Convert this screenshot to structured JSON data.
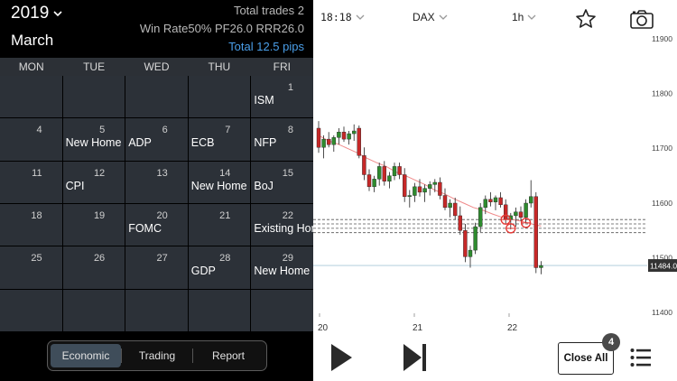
{
  "calendar": {
    "year": "2019",
    "month": "March",
    "stats": {
      "total_trades": "Total trades 2",
      "rates": "Win Rate50% PF26.0 RRR26.0",
      "total_pips": "Total 12.5 pips"
    },
    "weekdays": [
      "MON",
      "TUE",
      "WED",
      "THU",
      "FRI"
    ],
    "cells": [
      {
        "day": "",
        "event": ""
      },
      {
        "day": "",
        "event": ""
      },
      {
        "day": "",
        "event": ""
      },
      {
        "day": "",
        "event": ""
      },
      {
        "day": "1",
        "event": "ISM"
      },
      {
        "day": "4",
        "event": ""
      },
      {
        "day": "5",
        "event": "New Home"
      },
      {
        "day": "6",
        "event": "ADP"
      },
      {
        "day": "7",
        "event": "ECB"
      },
      {
        "day": "8",
        "event": "NFP"
      },
      {
        "day": "11",
        "event": ""
      },
      {
        "day": "12",
        "event": "CPI"
      },
      {
        "day": "13",
        "event": ""
      },
      {
        "day": "14",
        "event": "New Home"
      },
      {
        "day": "15",
        "event": "BoJ"
      },
      {
        "day": "18",
        "event": ""
      },
      {
        "day": "19",
        "event": ""
      },
      {
        "day": "20",
        "event": "FOMC"
      },
      {
        "day": "21",
        "event": ""
      },
      {
        "day": "22",
        "event": "Existing Hor"
      },
      {
        "day": "25",
        "event": ""
      },
      {
        "day": "26",
        "event": ""
      },
      {
        "day": "27",
        "event": ""
      },
      {
        "day": "28",
        "event": "GDP"
      },
      {
        "day": "29",
        "event": "New Home"
      },
      {
        "day": "",
        "event": ""
      },
      {
        "day": "",
        "event": ""
      },
      {
        "day": "",
        "event": ""
      },
      {
        "day": "",
        "event": ""
      },
      {
        "day": "",
        "event": ""
      }
    ],
    "tabs": [
      {
        "label": "Economic",
        "active": true
      },
      {
        "label": "Trading",
        "active": false
      },
      {
        "label": "Report",
        "active": false
      }
    ]
  },
  "chart": {
    "time": "18:18",
    "symbol": "DAX",
    "interval": "1h",
    "price_labels": [
      "11900",
      "11800",
      "11700",
      "11600",
      "11500",
      "11400"
    ],
    "current_price": "11484.0",
    "date_labels": [
      "20",
      "21",
      "22"
    ],
    "close_all_label": "Close All",
    "open_positions_badge": "4"
  },
  "chart_data": {
    "type": "candlestick",
    "ylim": [
      11390,
      11910
    ],
    "y_ticks": [
      11400,
      11500,
      11600,
      11700,
      11800,
      11900
    ],
    "x_ticks": [
      "20",
      "21",
      "22"
    ],
    "last_price": 11484.0,
    "colors": {
      "up": "#2e8b2e",
      "down": "#c62828",
      "ma": "#f08a8a",
      "level": "#555555"
    },
    "moving_average": [
      11722,
      11712,
      11706,
      11698,
      11690,
      11680,
      11672,
      11665,
      11655,
      11648,
      11640,
      11632,
      11622,
      11615,
      11606,
      11598,
      11590,
      11585,
      11578,
      11572,
      11568,
      11565,
      11560,
      11556
    ],
    "levels": [
      11568,
      11560,
      11552,
      11544
    ],
    "candles": [
      {
        "o": 11735,
        "h": 11748,
        "l": 11690,
        "c": 11700
      },
      {
        "o": 11700,
        "h": 11722,
        "l": 11680,
        "c": 11715
      },
      {
        "o": 11715,
        "h": 11728,
        "l": 11700,
        "c": 11705
      },
      {
        "o": 11705,
        "h": 11722,
        "l": 11692,
        "c": 11718
      },
      {
        "o": 11718,
        "h": 11735,
        "l": 11705,
        "c": 11728
      },
      {
        "o": 11728,
        "h": 11738,
        "l": 11710,
        "c": 11715
      },
      {
        "o": 11715,
        "h": 11730,
        "l": 11705,
        "c": 11725
      },
      {
        "o": 11725,
        "h": 11742,
        "l": 11712,
        "c": 11730
      },
      {
        "o": 11735,
        "h": 11740,
        "l": 11680,
        "c": 11685
      },
      {
        "o": 11685,
        "h": 11700,
        "l": 11640,
        "c": 11650
      },
      {
        "o": 11650,
        "h": 11660,
        "l": 11620,
        "c": 11628
      },
      {
        "o": 11628,
        "h": 11648,
        "l": 11618,
        "c": 11642
      },
      {
        "o": 11642,
        "h": 11672,
        "l": 11630,
        "c": 11665
      },
      {
        "o": 11665,
        "h": 11675,
        "l": 11630,
        "c": 11638
      },
      {
        "o": 11638,
        "h": 11655,
        "l": 11625,
        "c": 11648
      },
      {
        "o": 11648,
        "h": 11672,
        "l": 11640,
        "c": 11665
      },
      {
        "o": 11665,
        "h": 11672,
        "l": 11642,
        "c": 11650
      },
      {
        "o": 11650,
        "h": 11662,
        "l": 11600,
        "c": 11610
      },
      {
        "o": 11610,
        "h": 11622,
        "l": 11590,
        "c": 11612
      },
      {
        "o": 11612,
        "h": 11635,
        "l": 11600,
        "c": 11628
      },
      {
        "o": 11628,
        "h": 11642,
        "l": 11610,
        "c": 11618
      },
      {
        "o": 11618,
        "h": 11632,
        "l": 11600,
        "c": 11625
      },
      {
        "o": 11625,
        "h": 11638,
        "l": 11612,
        "c": 11632
      },
      {
        "o": 11632,
        "h": 11642,
        "l": 11618,
        "c": 11636
      },
      {
        "o": 11636,
        "h": 11645,
        "l": 11605,
        "c": 11612
      },
      {
        "o": 11612,
        "h": 11625,
        "l": 11585,
        "c": 11590
      },
      {
        "o": 11590,
        "h": 11605,
        "l": 11572,
        "c": 11598
      },
      {
        "o": 11598,
        "h": 11608,
        "l": 11568,
        "c": 11575
      },
      {
        "o": 11575,
        "h": 11592,
        "l": 11540,
        "c": 11548
      },
      {
        "o": 11548,
        "h": 11560,
        "l": 11490,
        "c": 11500
      },
      {
        "o": 11500,
        "h": 11520,
        "l": 11480,
        "c": 11512
      },
      {
        "o": 11512,
        "h": 11562,
        "l": 11505,
        "c": 11555
      },
      {
        "o": 11555,
        "h": 11598,
        "l": 11545,
        "c": 11590
      },
      {
        "o": 11590,
        "h": 11612,
        "l": 11578,
        "c": 11605
      },
      {
        "o": 11605,
        "h": 11618,
        "l": 11592,
        "c": 11600
      },
      {
        "o": 11600,
        "h": 11612,
        "l": 11585,
        "c": 11608
      },
      {
        "o": 11608,
        "h": 11618,
        "l": 11590,
        "c": 11595
      },
      {
        "o": 11595,
        "h": 11605,
        "l": 11560,
        "c": 11568
      },
      {
        "o": 11568,
        "h": 11580,
        "l": 11550,
        "c": 11575
      },
      {
        "o": 11575,
        "h": 11590,
        "l": 11555,
        "c": 11582
      },
      {
        "o": 11582,
        "h": 11592,
        "l": 11565,
        "c": 11572
      },
      {
        "o": 11572,
        "h": 11605,
        "l": 11562,
        "c": 11598
      },
      {
        "o": 11598,
        "h": 11640,
        "l": 11590,
        "c": 11610
      },
      {
        "o": 11610,
        "h": 11618,
        "l": 11470,
        "c": 11480
      },
      {
        "o": 11480,
        "h": 11492,
        "l": 11468,
        "c": 11484
      }
    ],
    "trade_markers": [
      {
        "index": 37,
        "price": 11568
      },
      {
        "index": 38,
        "price": 11552
      },
      {
        "index": 41,
        "price": 11562
      }
    ]
  }
}
